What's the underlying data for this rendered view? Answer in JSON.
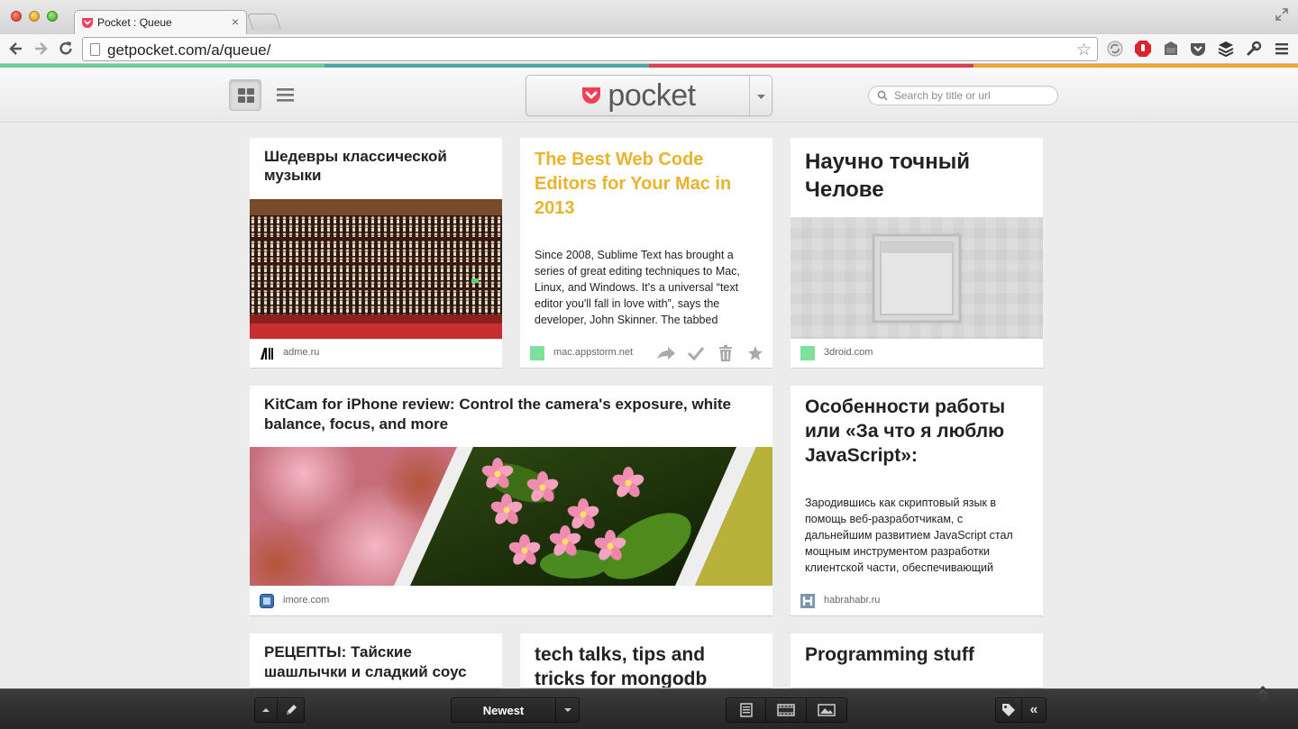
{
  "browser": {
    "tab_title": "Pocket : Queue",
    "tab_close": "×",
    "url": "getpocket.com/a/queue/"
  },
  "colors": {
    "stripe": [
      "#6fcb96",
      "#4ea4a8",
      "#d9414e",
      "#f0a434"
    ],
    "pocket_red": "#ee4056",
    "featured_title": "#eab32c"
  },
  "header": {
    "logo": "pocket",
    "search_placeholder": "Search by title or url"
  },
  "cards": [
    {
      "title": "Шедевры классической музыки",
      "domain": "adme.ru",
      "icon": "adme-favicon"
    },
    {
      "title": "The Best Web Code Editors for Your Mac in 2013",
      "excerpt": "Since 2008, Sublime Text has brought a series of great editing techniques to Mac, Linux, and Windows. It's a universal “text editor you'll fall in love with”, says the developer, John Skinner. The tabbed",
      "domain": "mac.appstorm.net",
      "icon": "green-square-favicon"
    },
    {
      "title": "Научно точный Челове",
      "domain": "3droid.com",
      "icon": "green-square-favicon"
    },
    {
      "title": "KitCam for iPhone review: Control the camera's exposure, white balance, focus, and more",
      "domain": "imore.com",
      "icon": "imore-favicon"
    },
    {
      "title": "Особенности работы или «За что я люблю JavaScript»:",
      "excerpt": "Зародившись как скриптовый язык в помощь веб-разработчикам, с дальнейшим развитием JavaScript стал мощным инструментом разработки клиентской части, обеспечивающий",
      "domain": "habrahabr.ru",
      "icon": "habr-favicon"
    },
    {
      "title": "РЕЦЕПТЫ: Тайские шашлычки и сладкий соус из..."
    },
    {
      "title": "tech talks, tips and tricks for mongodb"
    },
    {
      "title": "Programming stuff"
    }
  ],
  "bottombar": {
    "sort_label": "Newest",
    "collapse_label": "«"
  }
}
